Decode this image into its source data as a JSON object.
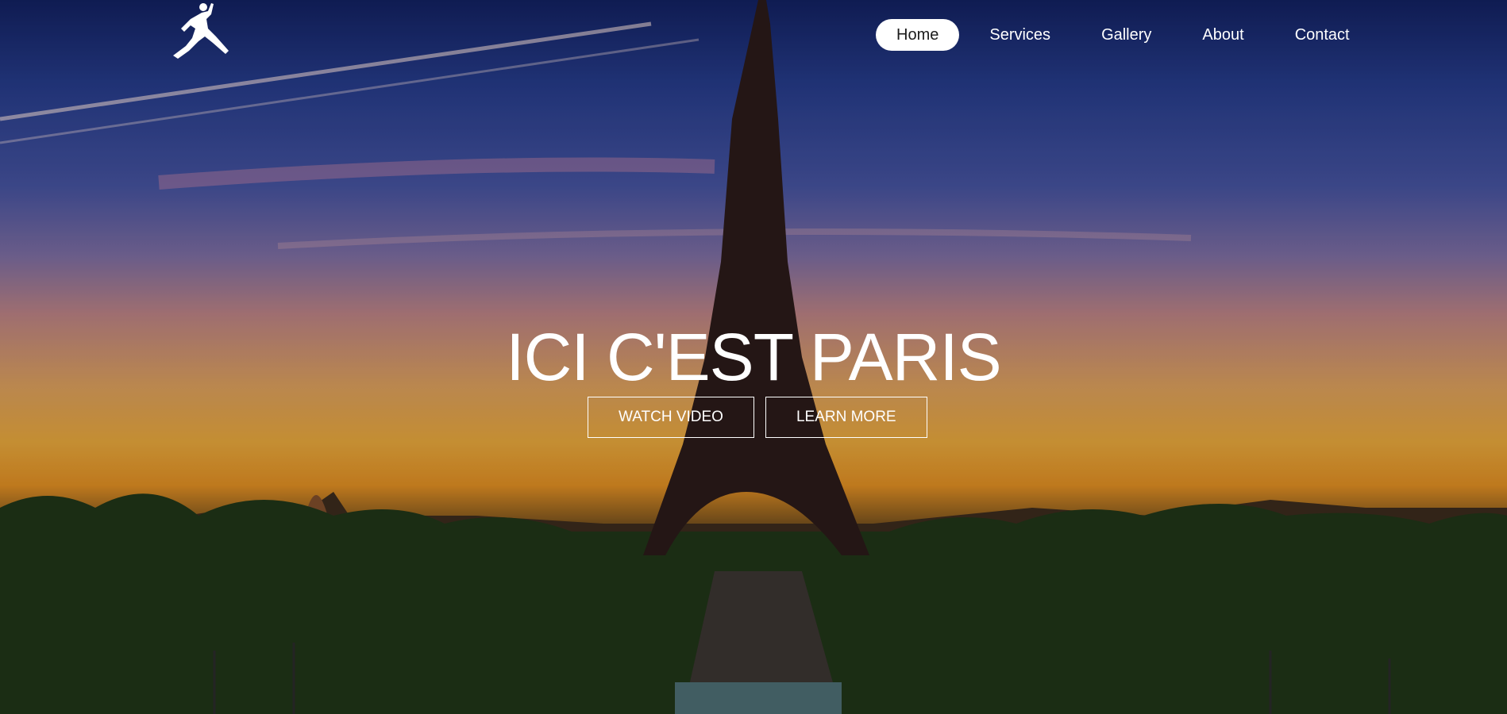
{
  "brand": {
    "logo_icon": "jumpman-logo-icon"
  },
  "nav": {
    "items": [
      {
        "label": "Home",
        "active": true
      },
      {
        "label": "Services",
        "active": false
      },
      {
        "label": "Gallery",
        "active": false
      },
      {
        "label": "About",
        "active": false
      },
      {
        "label": "Contact",
        "active": false
      }
    ]
  },
  "hero": {
    "title": "ICI C'EST PARIS",
    "buttons": [
      {
        "label": "WATCH VIDEO"
      },
      {
        "label": "LEARN MORE"
      }
    ],
    "background": "eiffel-tower-sunset-photo"
  },
  "colors": {
    "nav_active_bg": "#ffffff",
    "text": "#ffffff"
  }
}
